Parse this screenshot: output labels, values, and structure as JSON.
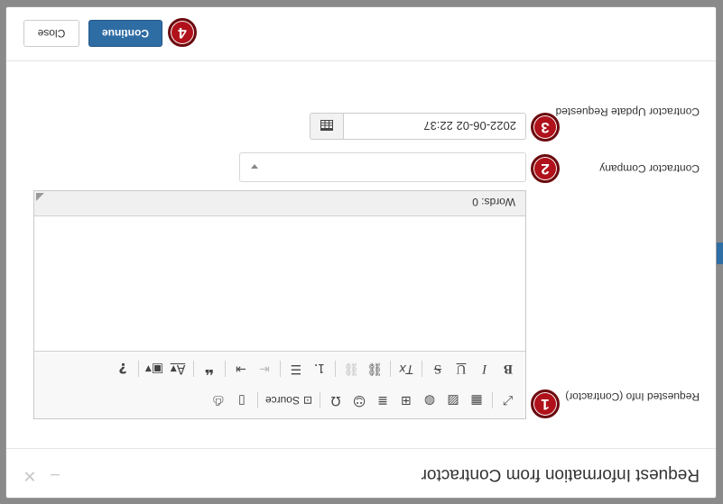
{
  "modal": {
    "title": "Request Information from Contractor",
    "minimize_icon": "minimize-icon",
    "close_icon": "close-icon"
  },
  "fields": {
    "requested_info": {
      "label": "Requested Info (Contractor)",
      "badge": "1"
    },
    "contractor_company": {
      "label": "Contractor Company",
      "badge": "2",
      "value": ""
    },
    "contractor_update": {
      "label": "Contractor Update Requested",
      "badge": "3",
      "value": "2022-06-02 22:37",
      "icon": "calendar-icon"
    }
  },
  "editor": {
    "toolbar_row1": [
      "maximize-icon",
      "templates-icon",
      "image-icon",
      "globe-icon",
      "table-icon",
      "horizontal-rule-icon",
      "smiley-icon",
      "special-char-icon"
    ],
    "source_label": "Source",
    "toolbar_row1_tail": [
      "blank-page-icon",
      "print-icon"
    ],
    "toolbar_row2": {
      "bold": "B",
      "italic": "I",
      "underline": "U",
      "strike": "S",
      "remove_format": "Tx",
      "quote": "❝",
      "help": "?"
    },
    "word_count": "Words: 0"
  },
  "footer": {
    "badge": "4",
    "continue_label": "Continue",
    "close_label": "Close"
  },
  "colors": {
    "primary": "#2e6ca4",
    "badge": "#b0111a"
  }
}
